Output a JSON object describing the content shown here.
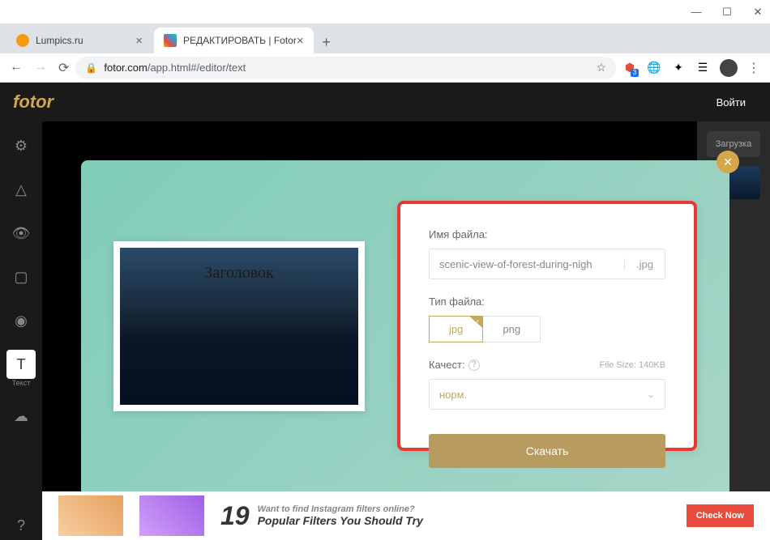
{
  "browser": {
    "tabs": [
      {
        "title": "Lumpics.ru",
        "favicon_color": "#f39c12"
      },
      {
        "title": "РЕДАКТИРОВАТЬ | Fotor",
        "favicon_color": "linear-gradient(45deg,#f39c12,#e74c3c,#9b59b6,#3498db,#2ecc71)"
      }
    ],
    "url_domain": "fotor.com",
    "url_path": "/app.html#/editor/text"
  },
  "app": {
    "logo": "fotor",
    "login": "Войти",
    "toolbar": {
      "text_label": "Текст"
    },
    "right_panel": {
      "load_button": "Загрузка"
    },
    "banner": {
      "number": "19",
      "line1": "Want to find Instagram filters online?",
      "line2": "Popular Filters You Should Try",
      "cta": "Check Now"
    }
  },
  "preview": {
    "title_text": "Заголовок"
  },
  "export": {
    "filename_label": "Имя файла:",
    "filename_value": "scenic-view-of-forest-during-nigh",
    "filename_ext": ".jpg",
    "filetype_label": "Тип файла:",
    "filetype_options": [
      "jpg",
      "png"
    ],
    "quality_label": "Качест:",
    "file_size": "File Size: 140KB",
    "quality_value": "норм.",
    "download_button": "Скачать"
  }
}
